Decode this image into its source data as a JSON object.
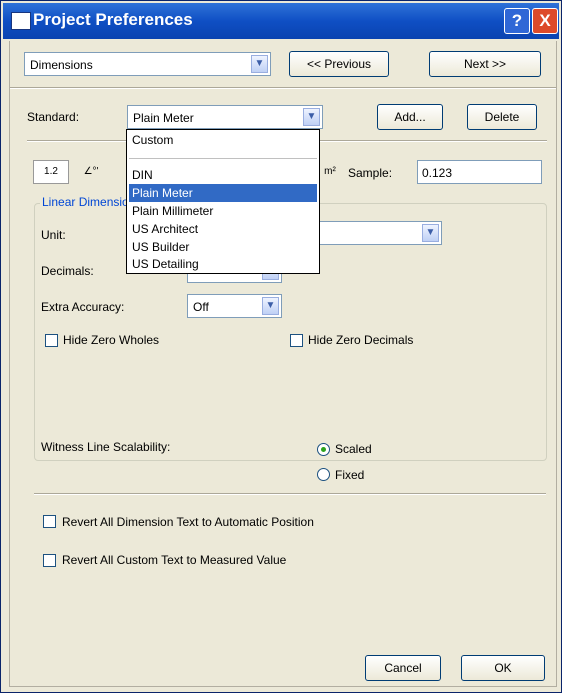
{
  "window": {
    "title": "Project Preferences",
    "help_label": "?",
    "close_label": "X"
  },
  "top": {
    "category_value": "Dimensions",
    "prev_label": "<< Previous",
    "next_label": "Next >>"
  },
  "standard": {
    "label": "Standard:",
    "value": "Plain Meter",
    "add_label": "Add...",
    "delete_label": "Delete"
  },
  "dropdown_options": [
    "Custom",
    "DIN",
    "Plain Meter",
    "Plain Millimeter",
    "US Architect",
    "US Builder",
    "US Detailing"
  ],
  "dropdown_selected": "Plain Meter",
  "tabs": {
    "linear_icon": "1.2",
    "angle_icon": "∠°'",
    "area_icon": "m²"
  },
  "sample": {
    "label": "Sample:",
    "value": "0.123"
  },
  "linear": {
    "group_title": "Linear Dimensions",
    "unit_label": "Unit:",
    "decimals_label": "Decimals:",
    "extra_accuracy_label": "Extra Accuracy:",
    "extra_accuracy_value": "Off",
    "hide_zero_wholes_label": "Hide Zero Wholes",
    "hide_zero_decimals_label": "Hide Zero Decimals"
  },
  "witness": {
    "label": "Witness Line Scalability:",
    "scaled_label": "Scaled",
    "fixed_label": "Fixed",
    "selected": "Scaled"
  },
  "revert": {
    "position_label": "Revert All Dimension Text to Automatic Position",
    "custom_label": "Revert All Custom Text to Measured Value"
  },
  "footer": {
    "cancel_label": "Cancel",
    "ok_label": "OK"
  },
  "colors": {
    "title_bar": "#0f4fc4",
    "selection": "#316ac5",
    "group_title": "#0046d5",
    "radio_dot": "#2ca31c"
  }
}
